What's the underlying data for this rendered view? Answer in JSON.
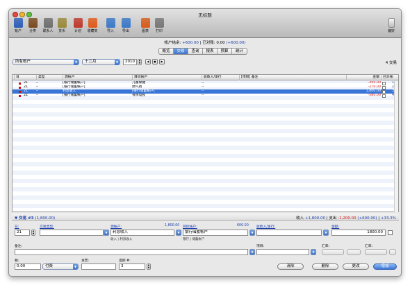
{
  "window": {
    "title": "无标题"
  },
  "toolbar": {
    "left": [
      {
        "label": "帐户",
        "icon": "account-icon",
        "color": "#2d5fb8"
      },
      {
        "label": "分类",
        "icon": "category-icon",
        "color": "#7a4a1e"
      },
      {
        "label": "联系人",
        "icon": "contact-icon",
        "color": "#6e6e6e"
      },
      {
        "label": "货币",
        "icon": "currency-icon",
        "color": "#9a8a3a"
      },
      {
        "label": "计划",
        "icon": "calendar-icon",
        "color": "#c0392b"
      },
      {
        "label": "收藏夹",
        "icon": "favorites-icon",
        "color": "#e05a1a"
      },
      {
        "label": "导入",
        "icon": "import-icon",
        "color": "#3a78c8"
      },
      {
        "label": "导出",
        "icon": "export-icon",
        "color": "#3a78c8"
      },
      {
        "label": "图表",
        "icon": "chart-icon",
        "color": "#d85a1a"
      },
      {
        "label": "打印",
        "icon": "print-icon",
        "color": "#777777"
      }
    ],
    "right": {
      "label": "偏好",
      "icon": "preferences-icon"
    }
  },
  "summary": {
    "balance_label": "帐户结余:",
    "balance": "+600.00",
    "sep": "| 已对账:",
    "reconciled": "0.00",
    "reconciled_paren": "(+600.00)"
  },
  "tabs": [
    "概览",
    "交易",
    "查询",
    "报表",
    "预算",
    "统计"
  ],
  "active_tab": 1,
  "filters": {
    "account": "所有帐户",
    "month": "十二月",
    "year": "2010",
    "prev": "◀",
    "play": "●",
    "next": "▶",
    "tx_count": "4 交易"
  },
  "table": {
    "headers": [
      "日",
      "类型",
      "源帐户",
      "目标帐户",
      "收款人/发行",
      "[项目] 备注",
      "金额",
      "已对帐"
    ],
    "rows": [
      {
        "day": "21",
        "type": "--",
        "source": "[银行储蓄帐户]",
        "target": "儿童保健",
        "payee": "--",
        "memo": "",
        "amount": "-350.00",
        "neg": true,
        "num": "1"
      },
      {
        "day": "21",
        "type": "--",
        "source": "[银行储蓄帐户]",
        "target": "燃气费",
        "payee": "--",
        "memo": "",
        "amount": "-270.00",
        "neg": true,
        "num": "2"
      },
      {
        "day": "21",
        "type": "--",
        "source": "利息收入",
        "target": "[银行储蓄帐户]",
        "payee": "--",
        "memo": "",
        "amount": "1,800.00",
        "neg": false,
        "num": "3",
        "selected": true
      },
      {
        "day": "21",
        "type": "--",
        "source": "[银行储蓄帐户]",
        "target": "有线电视",
        "payee": "--",
        "memo": "",
        "amount": "-580.00",
        "neg": true,
        "num": "4"
      }
    ]
  },
  "detail": {
    "title": "交易 #3",
    "title_amount": "(1,800.00)",
    "sum_in_label": "收入",
    "sum_in": "+1,800.00",
    "sum_out_label": "| 支出",
    "sum_out": "-1,200.00",
    "sum_net": "(+600.00)",
    "sum_pct": "+33.3%",
    "day_label": "日:",
    "day_value": "21",
    "type_label": "交易类型:",
    "type_value": "",
    "source_label": "源帐户:",
    "source_amount": "1,800.00",
    "source_value": "利息收入",
    "source_hint": "收入 | 利息收入",
    "target_label": "目标帐户:",
    "target_amount": "600.00",
    "target_value": "银行储蓄帐户",
    "target_hint": "银行 | 储蓄帐户",
    "payee_label": "收款人/发行:",
    "payee_value": "",
    "amount_label": "金额:",
    "amount_value": "1800.00",
    "memo_label": "备注:",
    "project_label": "项目:",
    "rate_label1": "汇率:",
    "rate_label2": "汇率:",
    "tax_label": "税:",
    "tax_value": "0.00",
    "payment_value": "付费",
    "invoice_label": "发票:",
    "installment_label": "追踪 #:",
    "installment_value": "3",
    "btn_clear": "清除",
    "btn_delete": "删除",
    "btn_update": "更改",
    "btn_add": "增加"
  }
}
